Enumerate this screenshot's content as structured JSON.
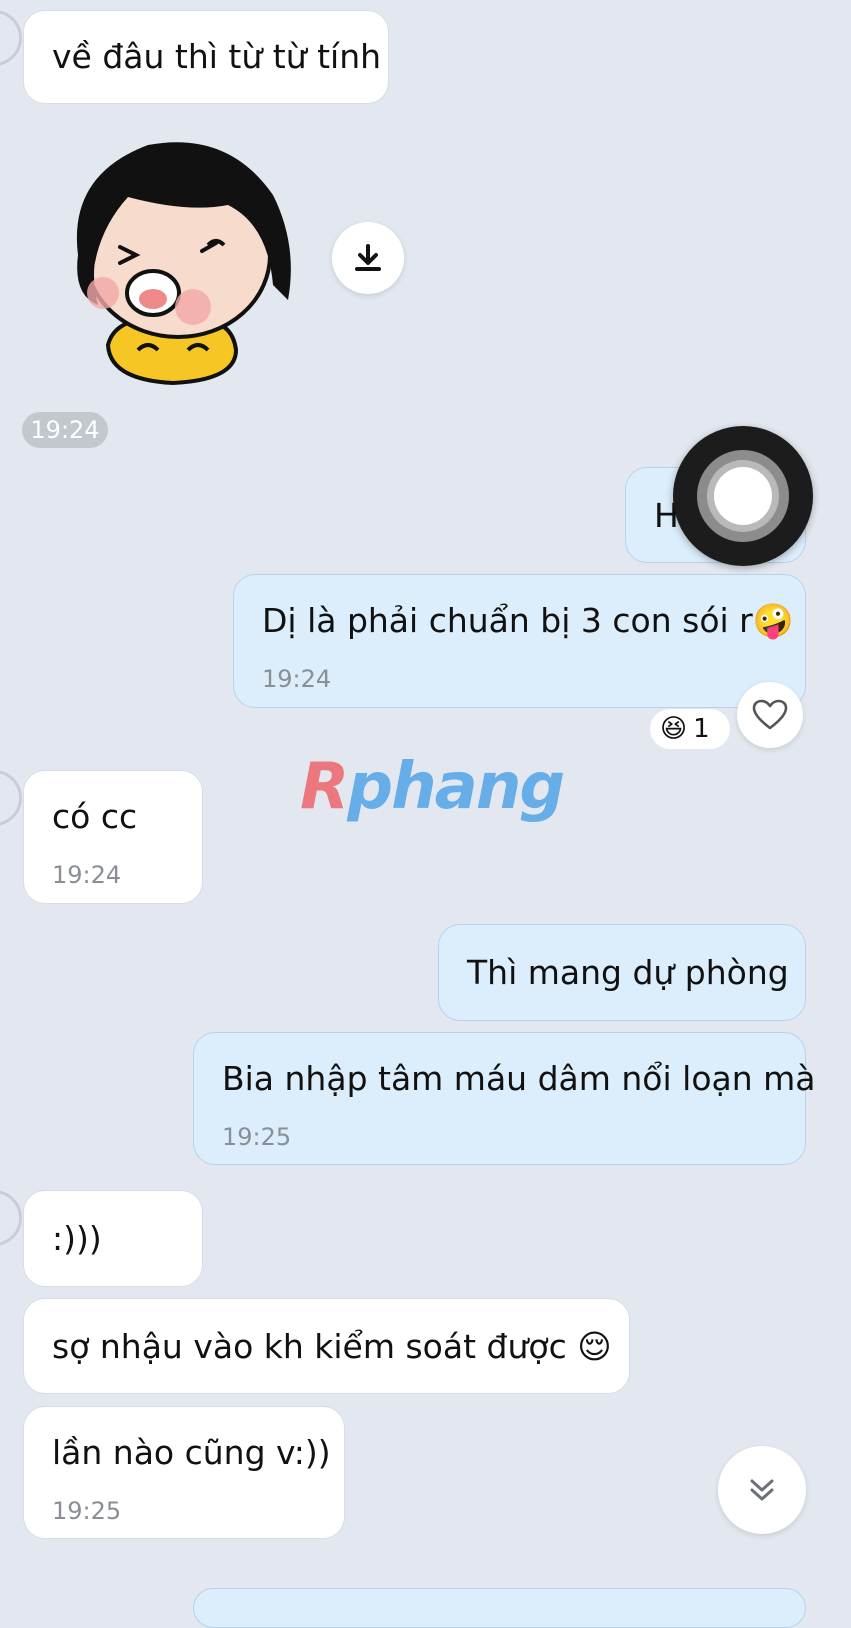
{
  "messages": {
    "m1": {
      "text": "về đâu thì từ từ tính"
    },
    "sticker_time": "19:24",
    "m2": {
      "text": "H"
    },
    "m3": {
      "text": "Dị là phải chuẩn bị 3 con sói r",
      "emoji": "🤪",
      "time": "19:24"
    },
    "reaction": {
      "emoji": "😆",
      "count": "1"
    },
    "m4": {
      "text": "có cc",
      "time": "19:24"
    },
    "m5": {
      "text": "Thì mang dự phòng"
    },
    "m6": {
      "text": "Bia nhập tâm máu dâm nổi loạn mà",
      "time": "19:25"
    },
    "m7": {
      "text": ":)))"
    },
    "m8": {
      "text": "sợ nhậu vào kh kiểm soát được",
      "emoji": "😌"
    },
    "m9": {
      "text": "lần nào cũng v:))",
      "time": "19:25"
    }
  },
  "watermark": {
    "first": "R",
    "rest": "phang"
  },
  "icons": {
    "download": "download-icon",
    "heart": "heart-icon",
    "scroll_down": "chevron-double-down-icon",
    "assistive_touch": "assistive-touch-icon"
  },
  "colors": {
    "background": "#e3e8f0",
    "incoming_bubble": "#ffffff",
    "outgoing_bubble": "#dcedfb",
    "time_text": "#8a8f96"
  }
}
